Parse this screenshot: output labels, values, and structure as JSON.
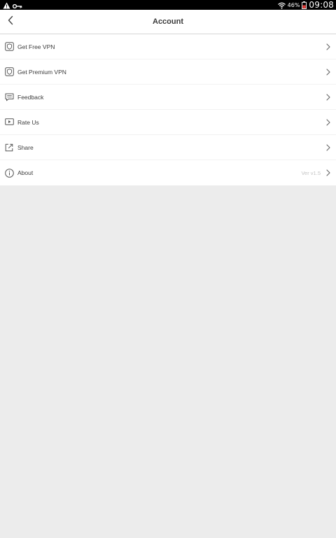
{
  "status_bar": {
    "battery_percent": "46%",
    "time": "09:08",
    "icons": [
      "warning-icon",
      "key-icon",
      "wifi-icon",
      "battery-icon"
    ]
  },
  "header": {
    "title": "Account",
    "back_icon": "back-chevron-icon"
  },
  "menu": {
    "items": [
      {
        "icon": "shield-icon",
        "label": "Get Free VPN",
        "value": ""
      },
      {
        "icon": "shield-icon",
        "label": "Get Premium VPN",
        "value": ""
      },
      {
        "icon": "chat-icon",
        "label": "Feedback",
        "value": ""
      },
      {
        "icon": "rate-icon",
        "label": "Rate Us",
        "value": ""
      },
      {
        "icon": "share-icon",
        "label": "Share",
        "value": ""
      },
      {
        "icon": "info-icon",
        "label": "About",
        "value": "Ver v1.5"
      }
    ]
  },
  "colors": {
    "background": "#ececec",
    "surface": "#ffffff",
    "text": "#3c3c3c",
    "muted": "#c4c4c4",
    "status_bar": "#000000"
  }
}
